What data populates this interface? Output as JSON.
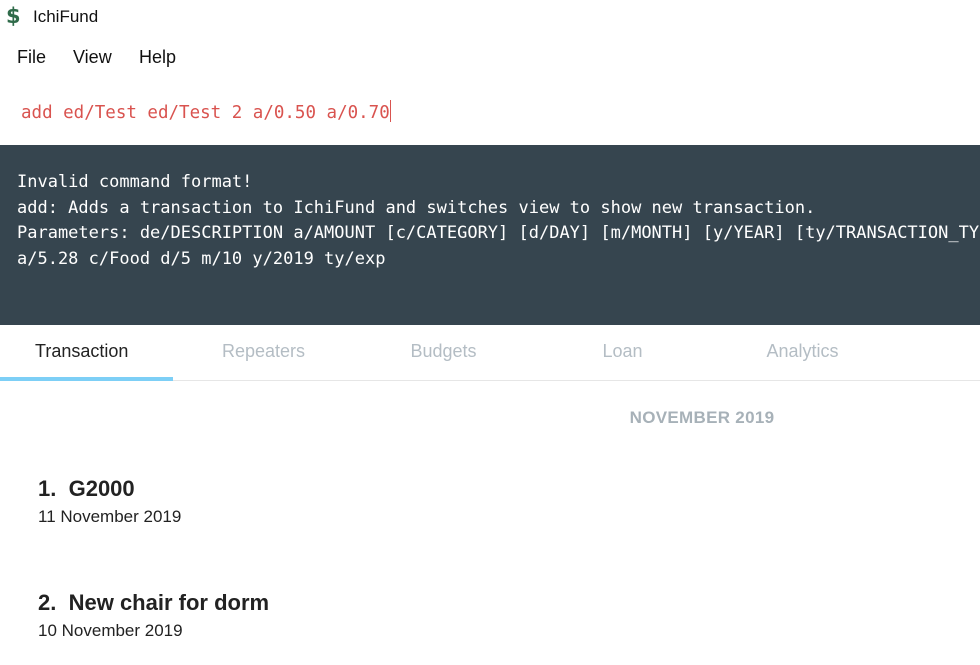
{
  "app": {
    "title": "IchiFund",
    "icon": "dollar-sign-icon"
  },
  "menu": {
    "items": [
      "File",
      "View",
      "Help"
    ]
  },
  "command": {
    "value": "add ed/Test ed/Test 2 a/0.50 a/0.70"
  },
  "result": {
    "lines": [
      "Invalid command format!",
      "add: Adds a transaction to IchiFund and switches view to show new transaction.",
      "Parameters: de/DESCRIPTION a/AMOUNT [c/CATEGORY] [d/DAY] [m/MONTH] [y/YEAR] [ty/TRANSACTION_TYPE]",
      "a/5.28 c/Food d/5 m/10 y/2019 ty/exp"
    ]
  },
  "tabs": [
    {
      "label": "Transaction",
      "active": true
    },
    {
      "label": "Repeaters",
      "active": false
    },
    {
      "label": "Budgets",
      "active": false
    },
    {
      "label": "Loan",
      "active": false
    },
    {
      "label": "Analytics",
      "active": false
    }
  ],
  "transactions": {
    "month_header": "NOVEMBER 2019",
    "items": [
      {
        "index": "1.",
        "description": "G2000",
        "date": "11 November 2019"
      },
      {
        "index": "2.",
        "description": "New chair for dorm",
        "date": "10 November 2019"
      }
    ]
  },
  "colors": {
    "command_text": "#d9534f",
    "result_background": "#36454f",
    "tab_indicator": "#7dcff6",
    "inactive_tab": "#b4bdc4",
    "month_header": "#a7b1b8"
  }
}
